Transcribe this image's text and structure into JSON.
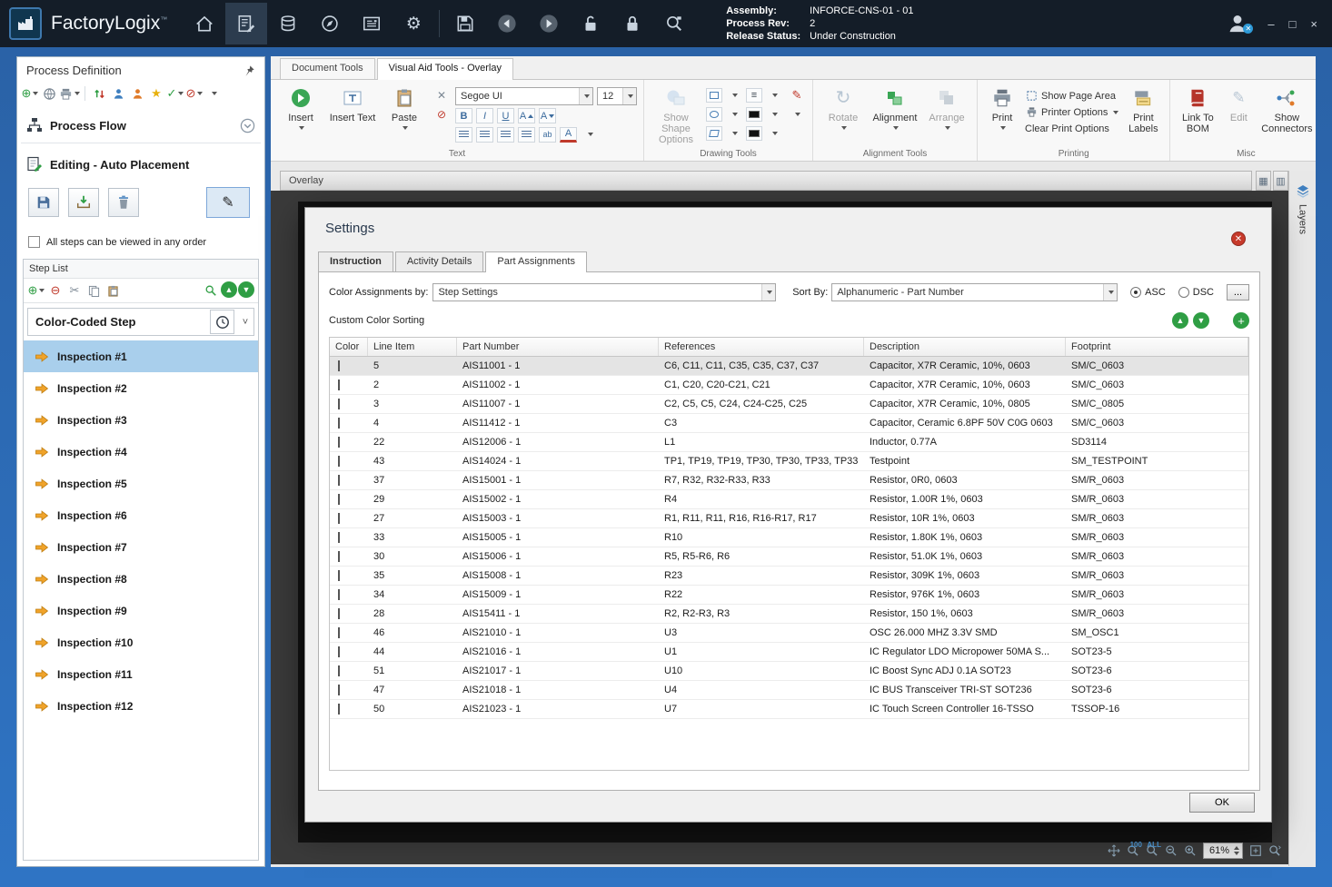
{
  "titlebar": {
    "app_name": "FactoryLogix",
    "trademark": "™",
    "assembly_label": "Assembly:",
    "assembly_value": "INFORCE-CNS-01 - 01",
    "process_rev_label": "Process Rev:",
    "process_rev_value": "2",
    "release_status_label": "Release Status:",
    "release_status_value": "Under Construction",
    "minimize_glyph": "–",
    "maximize_glyph": "□",
    "close_glyph": "×"
  },
  "sidebar": {
    "title": "Process Definition",
    "process_flow_label": "Process Flow",
    "editing_label": "Editing - Auto Placement",
    "order_checkbox_label": "All steps can be viewed in any order",
    "step_list_title": "Step List",
    "step_type_label": "Color-Coded Step",
    "steps": [
      {
        "label": "Inspection #1",
        "selected": true
      },
      {
        "label": "Inspection #2"
      },
      {
        "label": "Inspection #3"
      },
      {
        "label": "Inspection #4"
      },
      {
        "label": "Inspection #5"
      },
      {
        "label": "Inspection #6"
      },
      {
        "label": "Inspection #7"
      },
      {
        "label": "Inspection #8"
      },
      {
        "label": "Inspection #9"
      },
      {
        "label": "Inspection #10"
      },
      {
        "label": "Inspection #11"
      },
      {
        "label": "Inspection #12"
      }
    ]
  },
  "ribbon": {
    "tabs": [
      {
        "label": "Document Tools"
      },
      {
        "label": "Visual Aid Tools - Overlay",
        "active": true
      }
    ],
    "text_group": {
      "label": "Text",
      "insert_label": "Insert",
      "insert_text_label": "Insert Text",
      "paste_label": "Paste",
      "font_name": "Segoe UI",
      "font_size": "12"
    },
    "drawing_group": {
      "label": "Drawing Tools",
      "show_shape_options_label": "Show Shape Options"
    },
    "alignment_group": {
      "label": "Alignment Tools",
      "rotate_label": "Rotate",
      "alignment_label": "Alignment",
      "arrange_label": "Arrange"
    },
    "printing_group": {
      "label": "Printing",
      "print_label": "Print",
      "show_page_area_label": "Show Page Area",
      "printer_options_label": "Printer Options",
      "clear_print_options_label": "Clear Print Options",
      "print_labels_label": "Print Labels"
    },
    "misc_group": {
      "label": "Misc",
      "link_to_bom_label": "Link To BOM",
      "edit_label": "Edit",
      "show_connectors_label": "Show Connectors"
    }
  },
  "overlay_bar": {
    "title": "Overlay"
  },
  "layers_panel": {
    "tab_label": "Layers"
  },
  "settings_dialog": {
    "title": "Settings",
    "tabs": [
      {
        "label": "Instruction",
        "bold": true
      },
      {
        "label": "Activity Details"
      },
      {
        "label": "Part Assignments",
        "active": true
      }
    ],
    "color_assignments_label": "Color Assignments by:",
    "color_assignments_value": "Step Settings",
    "sort_by_label": "Sort By:",
    "sort_by_value": "Alphanumeric - Part Number",
    "asc_label": "ASC",
    "dsc_label": "DSC",
    "more_button_label": "...",
    "custom_color_sorting_label": "Custom Color Sorting",
    "ok_button_label": "OK",
    "parts_table": {
      "headers": [
        "Color",
        "Line Item",
        "Part Number",
        "References",
        "Description",
        "Footprint"
      ],
      "rows": [
        {
          "color": "#1f9d4b",
          "line_item": "5",
          "part_number": "AIS11001 - 1",
          "references": "C6, C11, C11, C35, C35, C37, C37",
          "description": "Capacitor, X7R Ceramic, 10%, 0603",
          "footprint": "SM/C_0603",
          "selected": true
        },
        {
          "color": "#2193d1",
          "line_item": "2",
          "part_number": "AIS11002 - 1",
          "references": "C1, C20, C20-C21, C21",
          "description": "Capacitor, X7R Ceramic, 10%, 0603",
          "footprint": "SM/C_0603"
        },
        {
          "color": "#e317a1",
          "line_item": "3",
          "part_number": "AIS11007 - 1",
          "references": "C2, C5, C5, C24, C24-C25, C25",
          "description": "Capacitor, X7R Ceramic, 10%, 0805",
          "footprint": "SM/C_0805"
        },
        {
          "color": "#efa0b0",
          "line_item": "4",
          "part_number": "AIS11412 - 1",
          "references": "C3",
          "description": "Capacitor, Ceramic 6.8PF 50V C0G 0603",
          "footprint": "SM/C_0603"
        },
        {
          "color": "#1f9d4b",
          "line_item": "22",
          "part_number": "AIS12006 - 1",
          "references": "L1",
          "description": "Inductor, 0.77A",
          "footprint": "SD3114"
        },
        {
          "color": "#2aa875",
          "line_item": "43",
          "part_number": "AIS14024 - 1",
          "references": "TP1, TP19, TP19, TP30, TP30, TP33, TP33",
          "description": "Testpoint",
          "footprint": "SM_TESTPOINT"
        },
        {
          "color": "#ee79b7",
          "line_item": "37",
          "part_number": "AIS15001 - 1",
          "references": "R7, R32, R32-R33, R33",
          "description": "Resistor, 0R0, 0603",
          "footprint": "SM/R_0603"
        },
        {
          "color": "#f26a1d",
          "line_item": "29",
          "part_number": "AIS15002 - 1",
          "references": "R4",
          "description": "Resistor, 1.00R 1%, 0603",
          "footprint": "SM/R_0603"
        },
        {
          "color": "#1f9d4b",
          "line_item": "27",
          "part_number": "AIS15003 - 1",
          "references": "R1, R11, R11, R16, R16-R17, R17",
          "description": "Resistor, 10R 1%, 0603",
          "footprint": "SM/R_0603"
        },
        {
          "color": "#2193d1",
          "line_item": "33",
          "part_number": "AIS15005 - 1",
          "references": "R10",
          "description": "Resistor, 1.80K 1%, 0603",
          "footprint": "SM/R_0603"
        },
        {
          "color": "#e317a1",
          "line_item": "30",
          "part_number": "AIS15006 - 1",
          "references": "R5, R5-R6, R6",
          "description": "Resistor, 51.0K 1%, 0603",
          "footprint": "SM/R_0603"
        },
        {
          "color": "#a4a41f",
          "line_item": "35",
          "part_number": "AIS15008 - 1",
          "references": "R23",
          "description": "Resistor, 309K 1%, 0603",
          "footprint": "SM/R_0603"
        },
        {
          "color": "#1f9d4b",
          "line_item": "34",
          "part_number": "AIS15009 - 1",
          "references": "R22",
          "description": "Resistor, 976K 1%, 0603",
          "footprint": "SM/R_0603"
        },
        {
          "color": "#1d3f6d",
          "line_item": "28",
          "part_number": "AIS15411 - 1",
          "references": "R2, R2-R3, R3",
          "description": "Resistor, 150 1%, 0603",
          "footprint": "SM/R_0603"
        },
        {
          "color": "#a30d20",
          "line_item": "46",
          "part_number": "AIS21010 - 1",
          "references": "U3",
          "description": "OSC 26.000 MHZ 3.3V SMD",
          "footprint": "SM_OSC1"
        },
        {
          "color": "#d5cdc3",
          "line_item": "44",
          "part_number": "AIS21016 - 1",
          "references": "U1",
          "description": "IC Regulator LDO Micropower 50MA S...",
          "footprint": "SOT23-5"
        },
        {
          "color": "#5d4126",
          "line_item": "51",
          "part_number": "AIS21017 - 1",
          "references": "U10",
          "description": "IC Boost Sync ADJ 0.1A SOT23",
          "footprint": "SOT23-6"
        },
        {
          "color": "#16a189",
          "line_item": "47",
          "part_number": "AIS21018 - 1",
          "references": "U4",
          "description": "IC BUS Transceiver TRI-ST SOT236",
          "footprint": "SOT23-6"
        },
        {
          "color": "#f4c36d",
          "line_item": "50",
          "part_number": "AIS21023 - 1",
          "references": "U7",
          "description": "IC Touch Screen Controller 16-TSSO",
          "footprint": "TSSOP-16"
        }
      ]
    }
  },
  "statusbar": {
    "zoom_value": "61%",
    "zoom_100_label": "100",
    "zoom_all_label": "ALL"
  },
  "colors": {
    "titlebar_bg": "#141d28",
    "window_frame": "#2f6db8",
    "selected_step_bg": "#a9cfec",
    "selected_row_bg": "#e4e4e4",
    "accent_green": "#2f9e44"
  },
  "icons_glyphs": {
    "gear": "⚙",
    "add": "⊕",
    "remove": "⊖",
    "cut": "✂",
    "pencil": "✎",
    "up": "▲",
    "down": "▼",
    "menu": "≡",
    "star": "★",
    "check": "✓",
    "blocked": "⊘",
    "rotate": "↻",
    "bold": "B",
    "italic": "I",
    "underline": "U",
    "letter_a": "A",
    "highlight_ab": "ab",
    "plus": "+",
    "grid": "▦",
    "grid_alt": "▥",
    "chevron": "˅",
    "x": "✕"
  }
}
